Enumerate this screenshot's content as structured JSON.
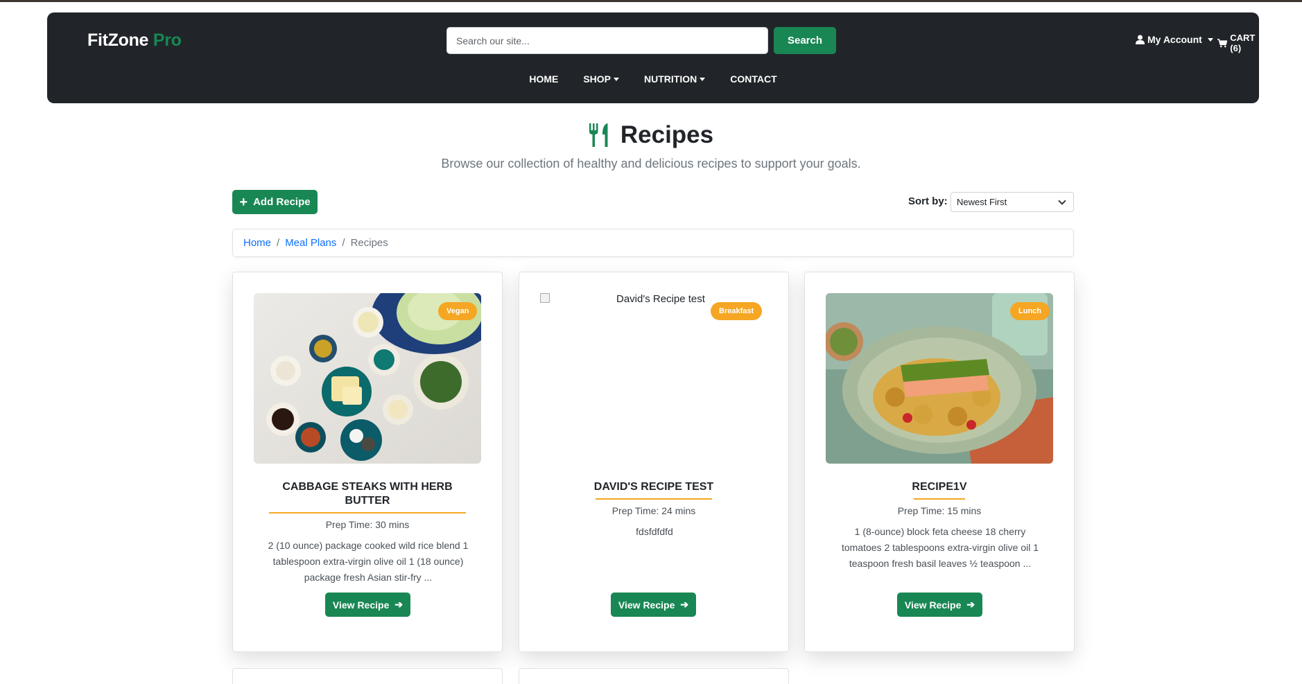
{
  "header": {
    "brand": "FitZone",
    "brand_accent": "Pro",
    "search_placeholder": "Search our site...",
    "search_button": "Search",
    "account": "My Account",
    "cart": "CART (6)",
    "nav": [
      "HOME",
      "SHOP",
      "NUTRITION",
      "CONTACT"
    ]
  },
  "page": {
    "title": "Recipes",
    "subtitle": "Browse our collection of healthy and delicious recipes to support your goals.",
    "add_button": "Add Recipe",
    "sort_label": "Sort by:",
    "sort_value": "Newest First"
  },
  "breadcrumb": {
    "home": "Home",
    "meal_plans": "Meal Plans",
    "current": "Recipes"
  },
  "recipes": [
    {
      "title_line1": "CABBAGE STEAKS WITH HERB",
      "title_line2": "BUTTER",
      "badge": "Vegan",
      "prep": "Prep Time: 30 mins",
      "desc": "2 (10 ounce) package cooked wild rice blend 1 tablespoon extra-virgin olive oil 1 (18 ounce) package fresh Asian stir-fry ...",
      "button": "View Recipe"
    },
    {
      "title_line1": "DAVID'S RECIPE TEST",
      "badge": "Breakfast",
      "image_alt": "David's Recipe test",
      "prep": "Prep Time: 24 mins",
      "desc": "fdsfdfdfd",
      "button": "View Recipe"
    },
    {
      "title_line1": "RECIPE1V",
      "badge": "Lunch",
      "prep": "Prep Time: 15 mins",
      "desc": "1 (8-ounce) block feta cheese 18 cherry tomatoes 2 tablespoons extra-virgin olive oil 1 teaspoon fresh basil leaves ½ teaspoon ...",
      "button": "View Recipe"
    }
  ],
  "colors": {
    "primary": "#198754",
    "badge": "#f5a623",
    "header_bg": "#212529",
    "link": "#0d6efd"
  }
}
